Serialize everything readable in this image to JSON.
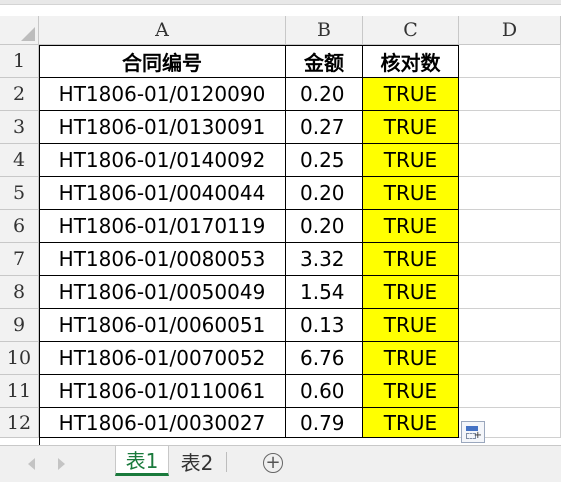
{
  "columns": [
    "A",
    "B",
    "C",
    "D"
  ],
  "rows": [
    "1",
    "2",
    "3",
    "4",
    "5",
    "6",
    "7",
    "8",
    "9",
    "10",
    "11",
    "12"
  ],
  "header": {
    "contract_no": "合同编号",
    "amount": "金额",
    "check": "核对数"
  },
  "data": [
    {
      "contract_no": "HT1806-01/0120090",
      "amount": "0.20",
      "check": "TRUE"
    },
    {
      "contract_no": "HT1806-01/0130091",
      "amount": "0.27",
      "check": "TRUE"
    },
    {
      "contract_no": "HT1806-01/0140092",
      "amount": "0.25",
      "check": "TRUE"
    },
    {
      "contract_no": "HT1806-01/0040044",
      "amount": "0.20",
      "check": "TRUE"
    },
    {
      "contract_no": "HT1806-01/0170119",
      "amount": "0.20",
      "check": "TRUE"
    },
    {
      "contract_no": "HT1806-01/0080053",
      "amount": "3.32",
      "check": "TRUE"
    },
    {
      "contract_no": "HT1806-01/0050049",
      "amount": "1.54",
      "check": "TRUE"
    },
    {
      "contract_no": "HT1806-01/0060051",
      "amount": "0.13",
      "check": "TRUE"
    },
    {
      "contract_no": "HT1806-01/0070052",
      "amount": "6.76",
      "check": "TRUE"
    },
    {
      "contract_no": "HT1806-01/0110061",
      "amount": "0.60",
      "check": "TRUE"
    },
    {
      "contract_no": "HT1806-01/0030027",
      "amount": "0.79",
      "check": "TRUE"
    }
  ],
  "sheets": [
    "表1",
    "表2"
  ],
  "icons": {
    "add_sheet": "plus-circle-icon",
    "paste_options": "paste-options-icon"
  },
  "colors": {
    "highlight": "#ffff00",
    "active_tab": "#1a7a3c"
  }
}
